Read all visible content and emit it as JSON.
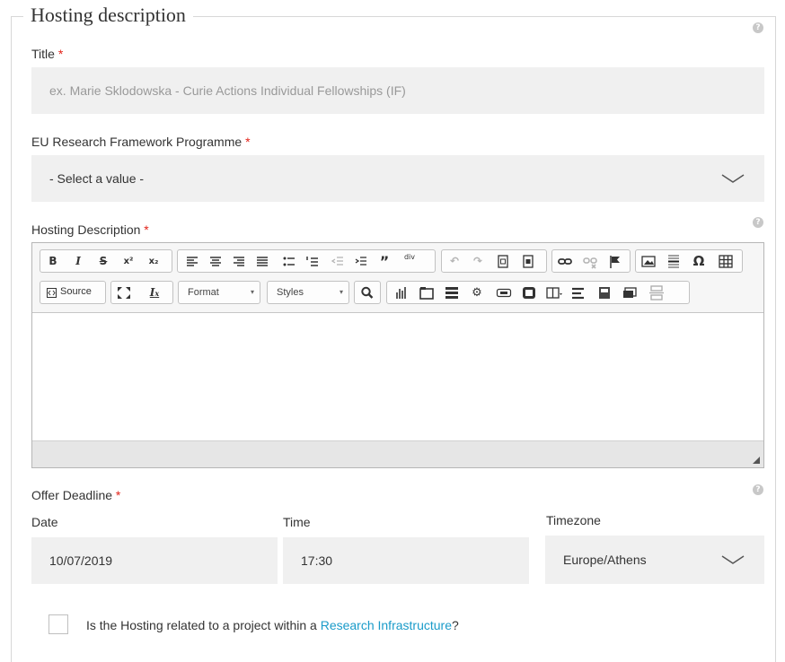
{
  "section": {
    "legend": "Hosting description"
  },
  "title_field": {
    "label": "Title",
    "required_mark": "*",
    "placeholder": "ex. Marie Sklodowska - Curie Actions Individual Fellowships (IF)"
  },
  "programme_field": {
    "label": "EU Research Framework Programme",
    "required_mark": "*",
    "value": "- Select a value -"
  },
  "description_field": {
    "label": "Hosting Description",
    "required_mark": "*"
  },
  "editor_toolbar": {
    "row1": [
      "B",
      "I",
      "S",
      "x²",
      "x₂",
      "align-left",
      "align-center",
      "align-right",
      "justify",
      "bulleted-list",
      "numbered-list",
      "outdent",
      "indent",
      "”",
      "div",
      "undo",
      "redo",
      "paste-text",
      "paste-word",
      "link",
      "unlink",
      "anchor",
      "image",
      "hr",
      "Ω",
      "table"
    ],
    "source_label": "Source",
    "format_label": "Format",
    "styles_label": "Styles"
  },
  "deadline": {
    "label": "Offer Deadline",
    "required_mark": "*",
    "date_label": "Date",
    "date_value": "10/07/2019",
    "time_label": "Time",
    "time_value": "17:30",
    "tz_label": "Timezone",
    "tz_value": "Europe/Athens"
  },
  "infrastructure": {
    "prefix": "Is the Hosting related to a project within a ",
    "link_text": "Research Infrastructure",
    "suffix": "?"
  },
  "help_icon_glyph": "?",
  "colors": {
    "accent_link": "#1a9bc9",
    "required": "#e2231a",
    "field_bg": "#f0f0f0"
  }
}
